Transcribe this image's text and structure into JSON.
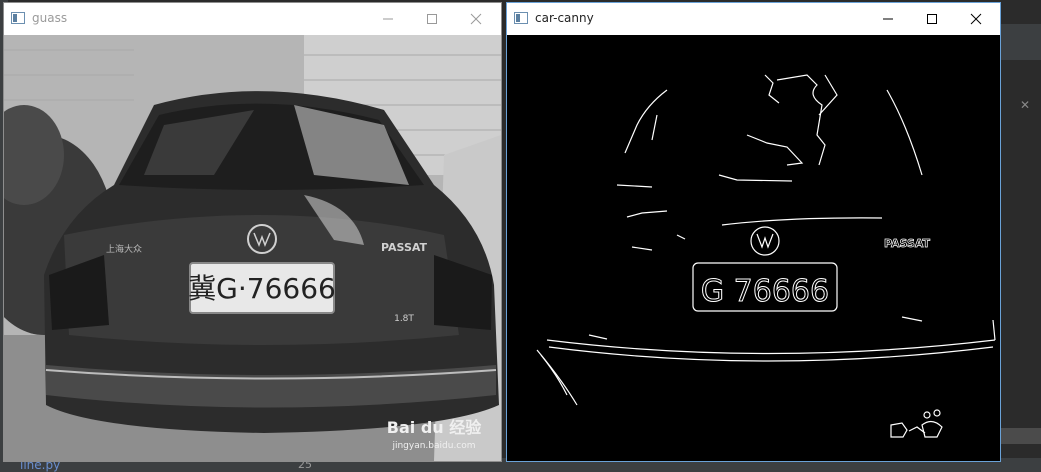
{
  "windows": [
    {
      "title": "guass",
      "state": "inactive"
    },
    {
      "title": "car-canny",
      "state": "active"
    }
  ],
  "gauss_image": {
    "plate_text": "冀G·76666",
    "brand_text": "PASSAT",
    "badge_text": "1.8T",
    "watermark": "Bai du 经验",
    "watermark_url": "jingyan.baidu.com"
  },
  "canny_image": {
    "plate_text": "G 76666",
    "brand_text": "PASSAT"
  },
  "background_ide": {
    "file_tab": "line.py",
    "line_number": "25"
  }
}
